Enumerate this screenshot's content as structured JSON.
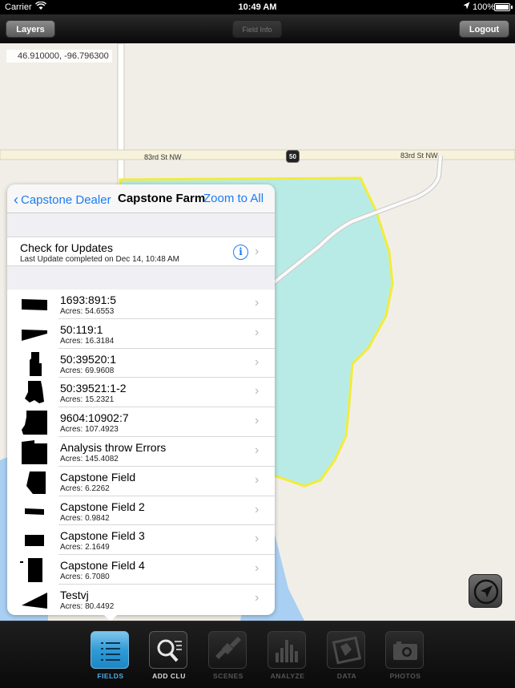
{
  "status_bar": {
    "carrier": "Carrier",
    "time": "10:49 AM",
    "battery": "100%"
  },
  "toolbar": {
    "layers_label": "Layers",
    "field_info_label": "Field Info",
    "logout_label": "Logout"
  },
  "map": {
    "coordinates": "46.910000, -96.796300",
    "road_label_left": "83rd St NW",
    "road_label_right": "83rd St NW",
    "route_shield": "50",
    "colors": {
      "background": "#f1eee8",
      "field_fill": "#b9ebe6",
      "field_outline": "#f2ec3a",
      "water": "#a9cff2",
      "road": "#f7f2dc"
    }
  },
  "popover": {
    "back_label": "Capstone Dealer",
    "title": "Capstone Farm",
    "zoom_label": "Zoom to All",
    "update": {
      "title": "Check for Updates",
      "subtitle": "Last Update completed on Dec 14, 10:48 AM"
    },
    "fields": [
      {
        "name": "1693:891:5",
        "acres": "Acres: 54.6553"
      },
      {
        "name": "50:119:1",
        "acres": "Acres: 16.3184"
      },
      {
        "name": "50:39520:1",
        "acres": "Acres: 69.9608"
      },
      {
        "name": "50:39521:1-2",
        "acres": "Acres: 15.2321"
      },
      {
        "name": "9604:10902:7",
        "acres": "Acres: 107.4923"
      },
      {
        "name": "Analysis throw Errors",
        "acres": "Acres: 145.4082"
      },
      {
        "name": "Capstone Field",
        "acres": "Acres: 6.2262"
      },
      {
        "name": "Capstone Field 2",
        "acres": "Acres: 0.9842"
      },
      {
        "name": "Capstone Field 3",
        "acres": "Acres: 2.1649"
      },
      {
        "name": "Capstone Field 4",
        "acres": "Acres: 6.7080"
      },
      {
        "name": "Testvj",
        "acres": "Acres: 80.4492"
      }
    ]
  },
  "tabbar": {
    "tabs": [
      {
        "label": "FIELDS",
        "icon": "fields-list-icon",
        "state": "active"
      },
      {
        "label": "ADD CLU",
        "icon": "add-clu-icon",
        "state": "enabled"
      },
      {
        "label": "SCENES",
        "icon": "satellite-icon",
        "state": "disabled"
      },
      {
        "label": "ANALYZE",
        "icon": "bar-chart-icon",
        "state": "disabled"
      },
      {
        "label": "DATA",
        "icon": "data-map-icon",
        "state": "disabled"
      },
      {
        "label": "PHOTOS",
        "icon": "camera-icon",
        "state": "disabled"
      }
    ]
  }
}
